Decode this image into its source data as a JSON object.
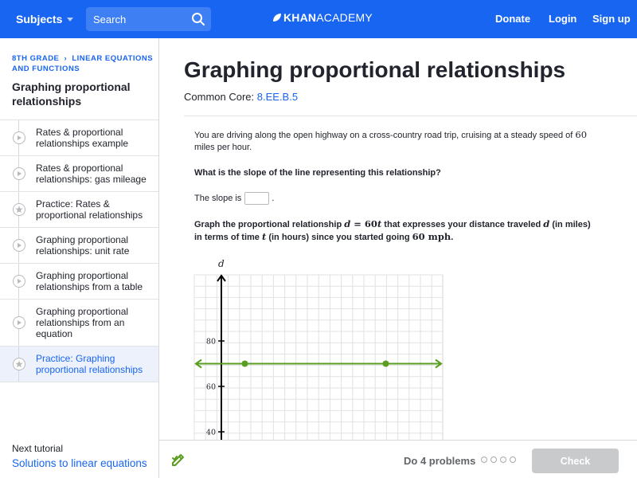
{
  "topbar": {
    "subjects_label": "Subjects",
    "search_placeholder": "Search",
    "logo_bold": "KHAN",
    "logo_rest": "ACADEMY",
    "donate": "Donate",
    "login": "Login",
    "signup": "Sign up",
    "brand_color": "#1865f2"
  },
  "sidebar": {
    "breadcrumb_grade": "8th grade",
    "breadcrumb_unit": "Linear equations and functions",
    "title": "Graphing proportional relationships",
    "items": [
      {
        "label": "Rates & proportional relationships example",
        "icon": "play-icon",
        "active": false
      },
      {
        "label": "Rates & proportional relationships: gas mileage",
        "icon": "play-icon",
        "active": false
      },
      {
        "label": "Practice: Rates & proportional relationships",
        "icon": "star-icon",
        "active": false
      },
      {
        "label": "Graphing proportional relationships: unit rate",
        "icon": "play-icon",
        "active": false
      },
      {
        "label": "Graphing proportional relationships from a table",
        "icon": "play-icon",
        "active": false
      },
      {
        "label": "Graphing proportional relationships from an equation",
        "icon": "play-icon",
        "active": false
      },
      {
        "label": "Practice: Graphing proportional relationships",
        "icon": "star-icon",
        "active": true
      }
    ],
    "next_label": "Next tutorial",
    "next_link": "Solutions to linear equations"
  },
  "main": {
    "title": "Graphing proportional relationships",
    "common_core_label": "Common Core:",
    "common_core_code": "8.EE.B.5",
    "q1_text_a": "You are driving along the open highway on a cross-country road trip, cruising at a steady speed of ",
    "q1_num": "60",
    "q1_text_b": " miles per hour.",
    "q2_text": "What is the slope of the line representing this relationship?",
    "q3_text": "The slope is",
    "q3_after": ".",
    "q4_a": "Graph the proportional relationship ",
    "q4_eq_d": "d",
    "q4_eq_rest": " = 60",
    "q4_eq_t": "t",
    "q4_b": " that expresses your distance traveled ",
    "q4_d": "d",
    "q4_c": " (in miles) in terms of time ",
    "q4_t": "t",
    "q4_d2": " (in hours) since you started going ",
    "q4_speed": "60 mph",
    "q4_end": "."
  },
  "graph": {
    "axis_label_y": "d",
    "y_ticks": [
      {
        "label": "80",
        "value": 80
      },
      {
        "label": "60",
        "value": 60
      },
      {
        "label": "40",
        "value": 40
      }
    ],
    "line_y_value": 70,
    "point_x_values": [
      1,
      7
    ],
    "line_color": "#5a9e1f"
  },
  "bottombar": {
    "do_text": "Do 4 problems",
    "progress_total": 4,
    "check_label": "Check"
  }
}
